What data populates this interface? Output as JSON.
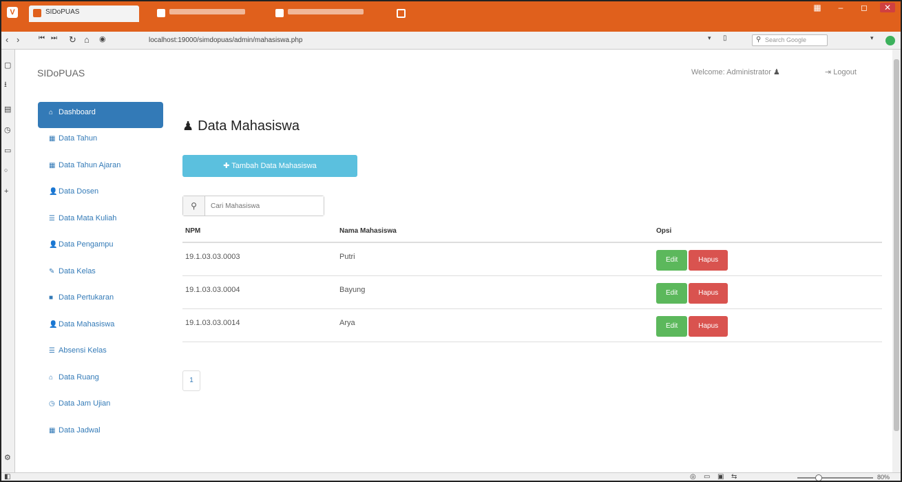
{
  "browser": {
    "tabs": [
      {
        "label": "SIDoPUAS",
        "active": true
      },
      {
        "label": "",
        "active": false
      },
      {
        "label": "",
        "active": false
      }
    ],
    "url": "localhost:19000/simdopuas/admin/mahasiswa.php",
    "search_placeholder": "Search Google",
    "zoom": "80%"
  },
  "header": {
    "brand": "SIDoPUAS",
    "welcome": "Welcome: Administrator",
    "logout": "Logout"
  },
  "sidebar": {
    "items": [
      {
        "label": "Dashboard",
        "icon": "home-icon",
        "glyph": "⌂",
        "active": true
      },
      {
        "label": "Data Tahun",
        "icon": "table-icon",
        "glyph": "▦"
      },
      {
        "label": "Data Tahun Ajaran",
        "icon": "table-icon",
        "glyph": "▦"
      },
      {
        "label": "Data Dosen",
        "icon": "user-icon",
        "glyph": "👤"
      },
      {
        "label": "Data Mata Kuliah",
        "icon": "list-icon",
        "glyph": "☰"
      },
      {
        "label": "Data Pengampu",
        "icon": "user-icon",
        "glyph": "👤"
      },
      {
        "label": "Data Kelas",
        "icon": "pencil-icon",
        "glyph": "✎"
      },
      {
        "label": "Data Pertukaran",
        "icon": "square-icon",
        "glyph": "■"
      },
      {
        "label": "Data Mahasiswa",
        "icon": "user-icon",
        "glyph": "👤"
      },
      {
        "label": "Absensi Kelas",
        "icon": "list-icon",
        "glyph": "☰"
      },
      {
        "label": "Data Ruang",
        "icon": "home-icon",
        "glyph": "⌂"
      },
      {
        "label": "Data Jam Ujian",
        "icon": "clock-icon",
        "glyph": "◷"
      },
      {
        "label": "Data Jadwal",
        "icon": "table-icon",
        "glyph": "▦"
      }
    ]
  },
  "main": {
    "title": "Data Mahasiswa",
    "add_button": "Tambah Data Mahasiswa",
    "search_placeholder": "Cari Mahasiswa",
    "columns": [
      "NPM",
      "Nama Mahasiswa",
      "Opsi"
    ],
    "rows": [
      {
        "npm": "19.1.03.03.0003",
        "nama": "Putri"
      },
      {
        "npm": "19.1.03.03.0004",
        "nama": "Bayung"
      },
      {
        "npm": "19.1.03.03.0014",
        "nama": "Arya"
      }
    ],
    "edit_label": "Edit",
    "delete_label": "Hapus",
    "page_number": "1"
  },
  "colors": {
    "titlebar": "#e0601c",
    "primary": "#337ab7",
    "info": "#5bc0de",
    "success": "#5cb85c",
    "danger": "#d9534f"
  }
}
